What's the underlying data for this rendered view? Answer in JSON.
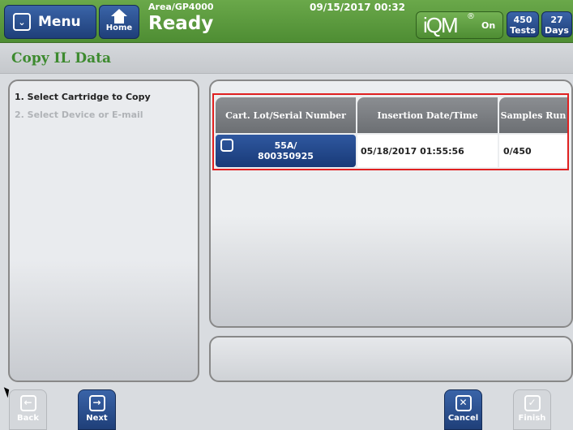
{
  "header": {
    "menu_label": "Menu",
    "home_label": "Home",
    "area": "Area/GP4000",
    "status": "Ready",
    "datetime": "09/15/2017 00:32",
    "iqm_logo": "iQM",
    "iqm_registered": "®",
    "iqm_state": "On",
    "tests_count": "450",
    "tests_label": "Tests",
    "days_count": "27",
    "days_label": "Days"
  },
  "page": {
    "title": "Copy IL Data"
  },
  "steps": [
    {
      "label": "1. Select Cartridge to Copy",
      "active": true
    },
    {
      "label": "2. Select Device or E-mail",
      "active": false
    }
  ],
  "table": {
    "columns": [
      "Cart. Lot/Serial Number",
      "Insertion Date/Time",
      "Samples Run"
    ],
    "rows": [
      {
        "cart_line1": "55A/",
        "cart_line2": "800350925",
        "insertion": "05/18/2017 01:55:56",
        "samples": "0/450",
        "selected": true
      }
    ]
  },
  "nav": {
    "back_label": "Back",
    "next_label": "Next",
    "cancel_label": "Cancel",
    "finish_label": "Finish"
  },
  "colors": {
    "header_green": "#5a9a3e",
    "button_blue": "#2a4f93",
    "title_green": "#3d8a2f",
    "highlight_red": "#e02020"
  }
}
